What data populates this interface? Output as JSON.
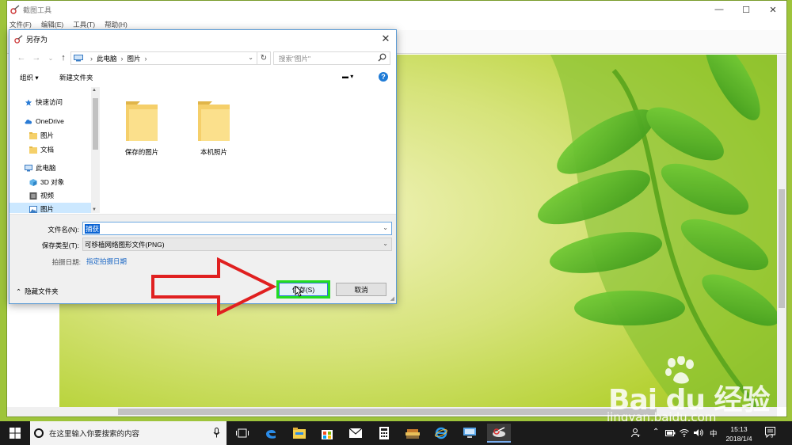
{
  "snip_window": {
    "title": "截图工具",
    "menu": [
      "文件(F)",
      "编辑(E)",
      "工具(T)",
      "帮助(H)"
    ],
    "controls": {
      "minimize": "—",
      "maximize": "☐",
      "close": "✕"
    }
  },
  "dialog": {
    "title": "另存为",
    "close": "✕",
    "nav": {
      "back": "←",
      "forward": "→",
      "recent": "⌄",
      "up": "↑"
    },
    "address": [
      "此电脑",
      "图片"
    ],
    "address_sep": "›",
    "search_placeholder": "搜索\"图片\"",
    "toolbar": {
      "organize": "组织 ▾",
      "new_folder": "新建文件夹",
      "view": "▬ ▾",
      "help": "?"
    },
    "nav_tree": [
      {
        "label": "快速访问",
        "icon": "star-icon",
        "indent": 0
      },
      {
        "label": "OneDrive",
        "icon": "cloud-icon",
        "indent": 0
      },
      {
        "label": "图片",
        "icon": "folder-icon",
        "indent": 1
      },
      {
        "label": "文档",
        "icon": "folder-icon",
        "indent": 1
      },
      {
        "label": "此电脑",
        "icon": "pc-icon",
        "indent": 0
      },
      {
        "label": "3D 对象",
        "icon": "cube-icon",
        "indent": 1
      },
      {
        "label": "视频",
        "icon": "video-icon",
        "indent": 1
      },
      {
        "label": "图片",
        "icon": "pictures-icon",
        "indent": 1,
        "selected": true
      }
    ],
    "folders": [
      {
        "name": "保存的图片"
      },
      {
        "name": "本机照片"
      }
    ],
    "filename_label": "文件名(N):",
    "filename_value": "捕获",
    "savetype_label": "保存类型(T):",
    "savetype_value": "可移植网络图形文件(PNG)",
    "tags_label": "拍摄日期:",
    "tags_link": "指定拍摄日期",
    "hide_folders": "隐藏文件夹",
    "save_button": "保存(S)",
    "cancel_button": "取消"
  },
  "watermark": {
    "brand": "Bai du 经验",
    "url": "jingyan.baidu.com"
  },
  "taskbar": {
    "search_placeholder": "在这里输入你要搜索的内容",
    "tray_icons": [
      "person-icon",
      "chevron-up-icon",
      "battery-icon",
      "wifi-icon",
      "volume-icon"
    ],
    "ime": "中",
    "time": "15:13",
    "date": "2018/1/4"
  },
  "colors": {
    "accent": "#0078d7",
    "highlight_box": "#22dd22",
    "arrow": "#e02020"
  }
}
